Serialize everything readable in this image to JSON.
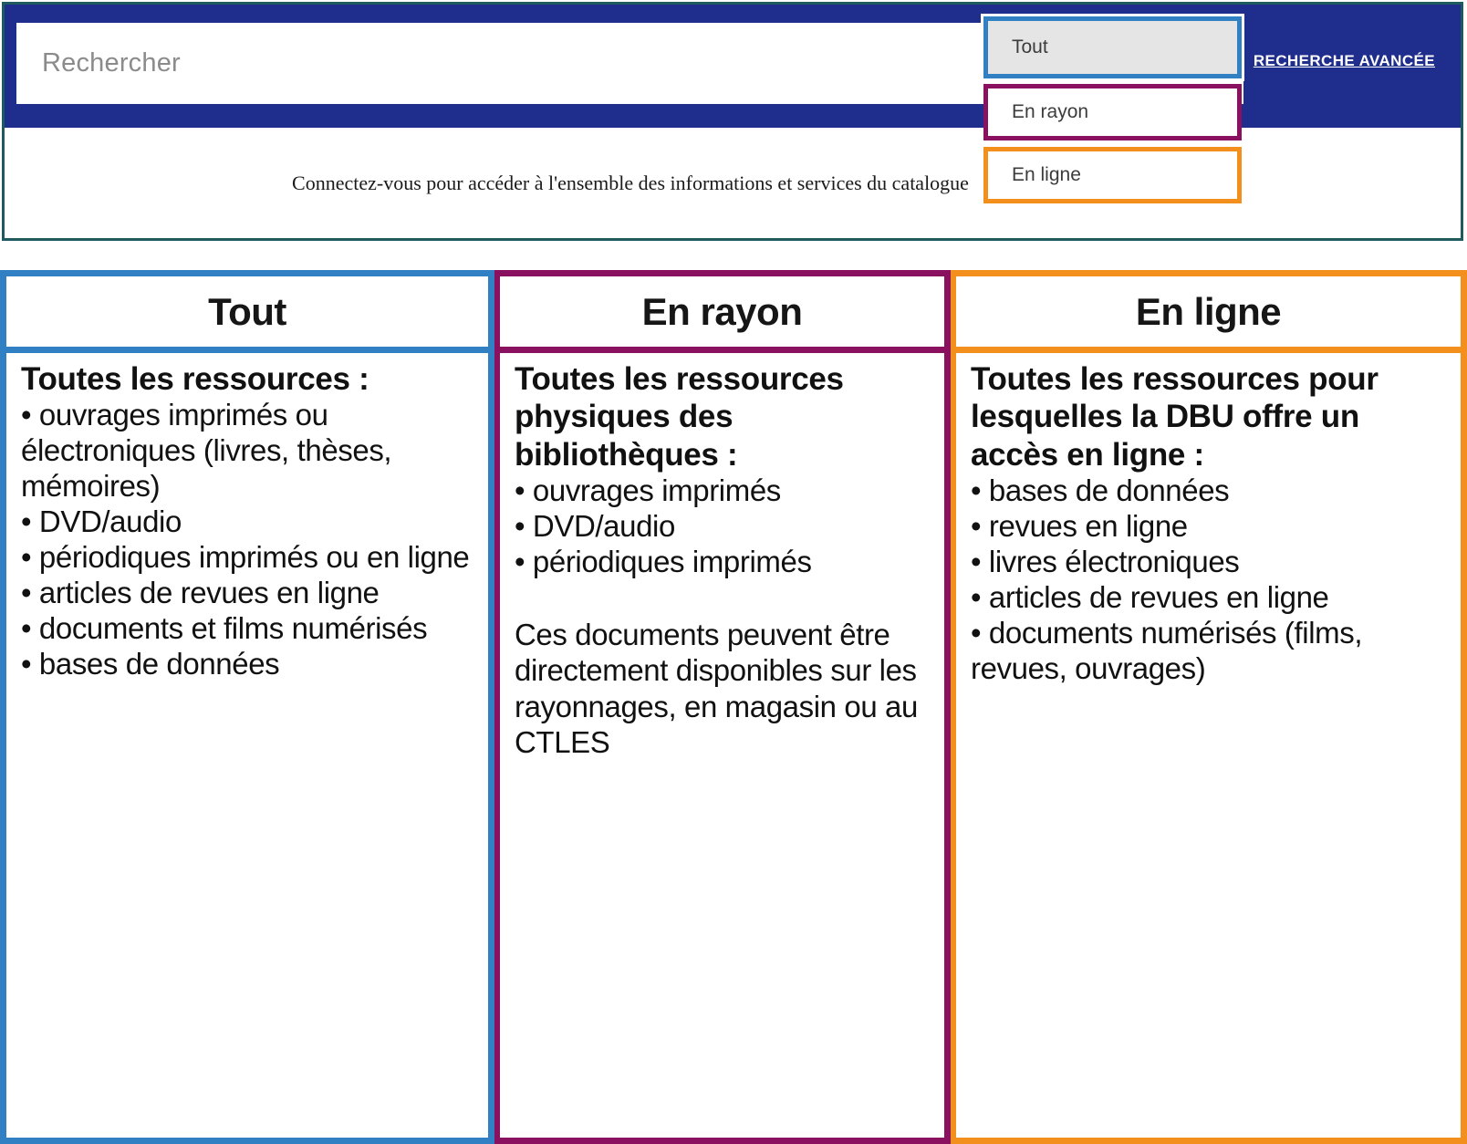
{
  "search": {
    "placeholder": "Rechercher",
    "advanced_link": "RECHERCHE AVANCÉE",
    "bar_color": "#1F2D8C",
    "panel_border_color": "#1F5B5E"
  },
  "connect": {
    "message": "Connectez-vous pour accéder à l'ensemble des informations et services du catalogue",
    "icon": "login-arrow-icon"
  },
  "dropdown": {
    "items": [
      {
        "label": "Tout",
        "color": "#3080C3",
        "selected": true
      },
      {
        "label": "En rayon",
        "color": "#8A1060",
        "selected": false
      },
      {
        "label": "En ligne",
        "color": "#F3901D",
        "selected": false
      }
    ]
  },
  "columns": [
    {
      "title": "Tout",
      "accent": "#3080C3",
      "lead": "Toutes les ressources :",
      "items": [
        "• ouvrages imprimés ou électroniques (livres, thèses, mémoires)",
        "• DVD/audio",
        "• périodiques imprimés ou en ligne",
        "• articles de revues en ligne",
        "• documents et films numérisés",
        "• bases de données"
      ],
      "note": ""
    },
    {
      "title": "En rayon",
      "accent": "#8A1060",
      "lead": "Toutes les ressources physiques des bibliothèques :",
      "items": [
        "• ouvrages imprimés",
        "• DVD/audio",
        "• périodiques imprimés"
      ],
      "note": "Ces documents peuvent être directement disponibles sur les rayonnages, en magasin ou au CTLES"
    },
    {
      "title": "En ligne",
      "accent": "#F3901D",
      "lead": "Toutes les ressources pour lesquelles la DBU offre un accès en ligne :",
      "items": [
        "• bases de données",
        "• revues en ligne",
        "• livres électroniques",
        "• articles de revues en ligne",
        "• documents numérisés (films, revues, ouvrages)"
      ],
      "note": ""
    }
  ]
}
